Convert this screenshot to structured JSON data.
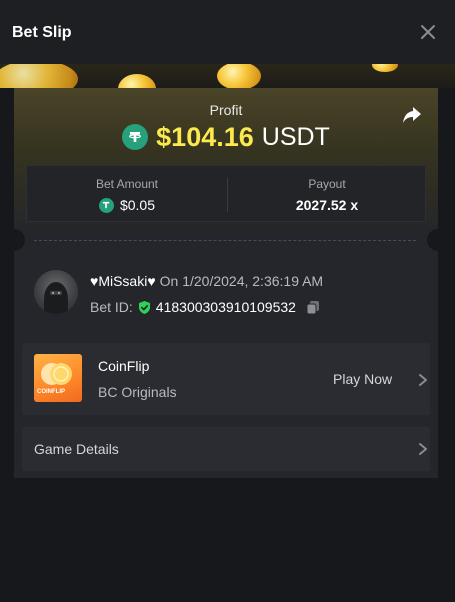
{
  "header": {
    "title": "Bet Slip"
  },
  "profit": {
    "label": "Profit",
    "amount": "$104.16",
    "currency": "USDT"
  },
  "stats": {
    "bet_amount_label": "Bet Amount",
    "bet_amount_value": "$0.05",
    "payout_label": "Payout",
    "payout_value": "2027.52 x"
  },
  "bet": {
    "username": "♥MiSsaki♥",
    "date": "On 1/20/2024, 2:36:19 AM",
    "bet_id_label": "Bet ID:",
    "bet_id": "418300303910109532"
  },
  "game": {
    "name": "CoinFlip",
    "provider": "BC Originals",
    "thumb_text": "COINFLIP",
    "play_label": "Play Now"
  },
  "details": {
    "label": "Game Details"
  },
  "icons": {
    "close": "close-icon",
    "share": "share-icon",
    "usdt": "tether-icon",
    "verified": "shield-check-icon",
    "copy": "copy-icon",
    "chevron": "chevron-right-icon"
  },
  "colors": {
    "profit_amount": "#fbe94e",
    "usdt": "#26a17b",
    "verified": "#2ed158",
    "background": "#17181b",
    "card": "#24262b"
  }
}
